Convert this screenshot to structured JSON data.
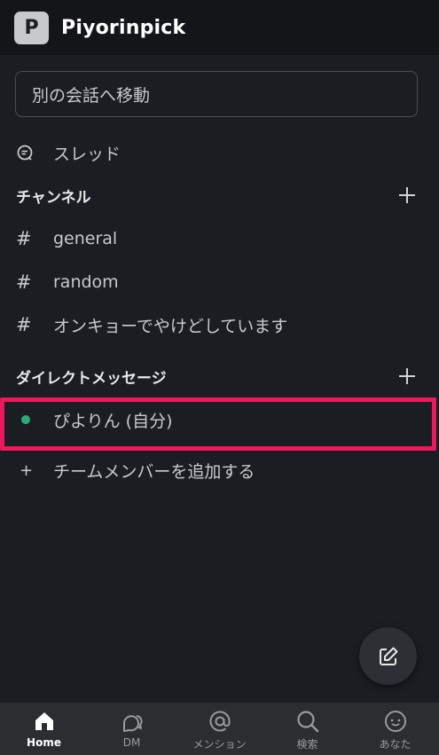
{
  "header": {
    "workspace_initial": "P",
    "workspace_name": "Piyorinpick"
  },
  "jump": {
    "placeholder": "別の会話へ移動"
  },
  "threads": {
    "label": "スレッド",
    "icon": "threads-icon"
  },
  "channels": {
    "title": "チャンネル",
    "items": [
      {
        "prefix": "#",
        "label": "general"
      },
      {
        "prefix": "#",
        "label": "random"
      },
      {
        "prefix": "#",
        "label": "オンキョーでやけどしています"
      }
    ]
  },
  "dms": {
    "title": "ダイレクトメッセージ",
    "self": {
      "label": "ぴよりん (自分)",
      "status_color": "#2bac76"
    },
    "add_member": {
      "prefix": "+",
      "label": "チームメンバーを追加する"
    }
  },
  "highlight_color": "#f0185a",
  "bottom_nav": [
    {
      "label": "Home",
      "icon": "home-icon",
      "active": true
    },
    {
      "label": "DM",
      "icon": "dm-icon",
      "active": false
    },
    {
      "label": "メンション",
      "icon": "mention-icon",
      "active": false
    },
    {
      "label": "検索",
      "icon": "search-icon",
      "active": false
    },
    {
      "label": "あなた",
      "icon": "you-icon",
      "active": false
    }
  ]
}
